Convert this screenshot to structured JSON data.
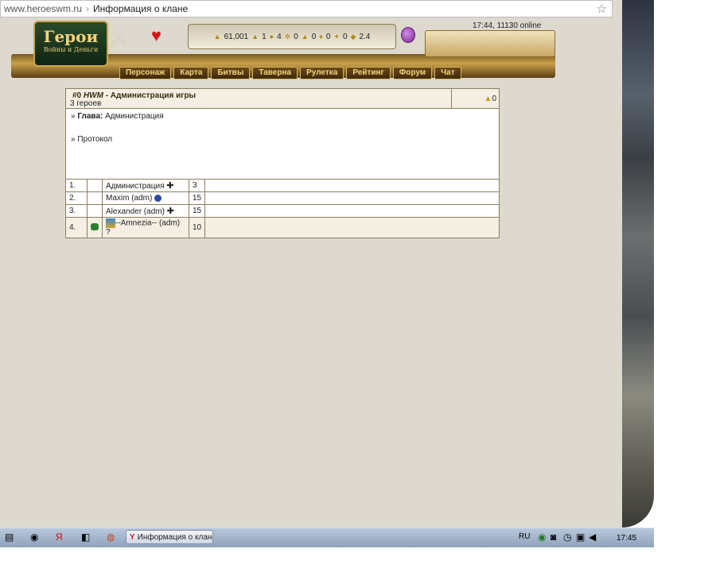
{
  "browser": {
    "url": "www.heroeswm.ru",
    "separator": "›",
    "page_title": "Информация о клане",
    "star_icon": "☆"
  },
  "header": {
    "logo_title": "Герои",
    "logo_subtitle": "Войны и Деньги",
    "resources": {
      "gold": "61,001",
      "wood": "1",
      "ore": "4",
      "mercury": "0",
      "sulfur": "0",
      "crystals": "0",
      "gems": "0",
      "diamonds": "2.4"
    },
    "time_online": "17:44, 11130 online"
  },
  "menu": [
    {
      "label": "Персонаж"
    },
    {
      "label": "Карта"
    },
    {
      "label": "Битвы"
    },
    {
      "label": "Таверна"
    },
    {
      "label": "Рулетка"
    },
    {
      "label": "Рейтинг"
    },
    {
      "label": "Форум"
    },
    {
      "label": "Чат"
    }
  ],
  "clan": {
    "id": "#0",
    "tag": "HWM",
    "name": "- Администрация игры",
    "count": "3 героев",
    "gold": "0",
    "head_label": "Глава:",
    "head_value": "Администрация",
    "protocol_label": "» Протокол",
    "head_prefix": "»"
  },
  "members": [
    {
      "num": "1.",
      "name": "Администрация",
      "level": "3",
      "badge": "cross-icon"
    },
    {
      "num": "2.",
      "name": "Maxim (adm)",
      "level": "15",
      "badge": "blue-orb-icon"
    },
    {
      "num": "3.",
      "name": "Alexander (adm)",
      "level": "15",
      "badge": "cross-icon"
    },
    {
      "num": "4.",
      "name": "--Amnezia-- (adm)",
      "level": "10",
      "badge": "avatar-icon",
      "extra": "?"
    }
  ],
  "taskbar": {
    "active_window": "Информация о клане...",
    "lang": "RU",
    "time": "17:45"
  }
}
